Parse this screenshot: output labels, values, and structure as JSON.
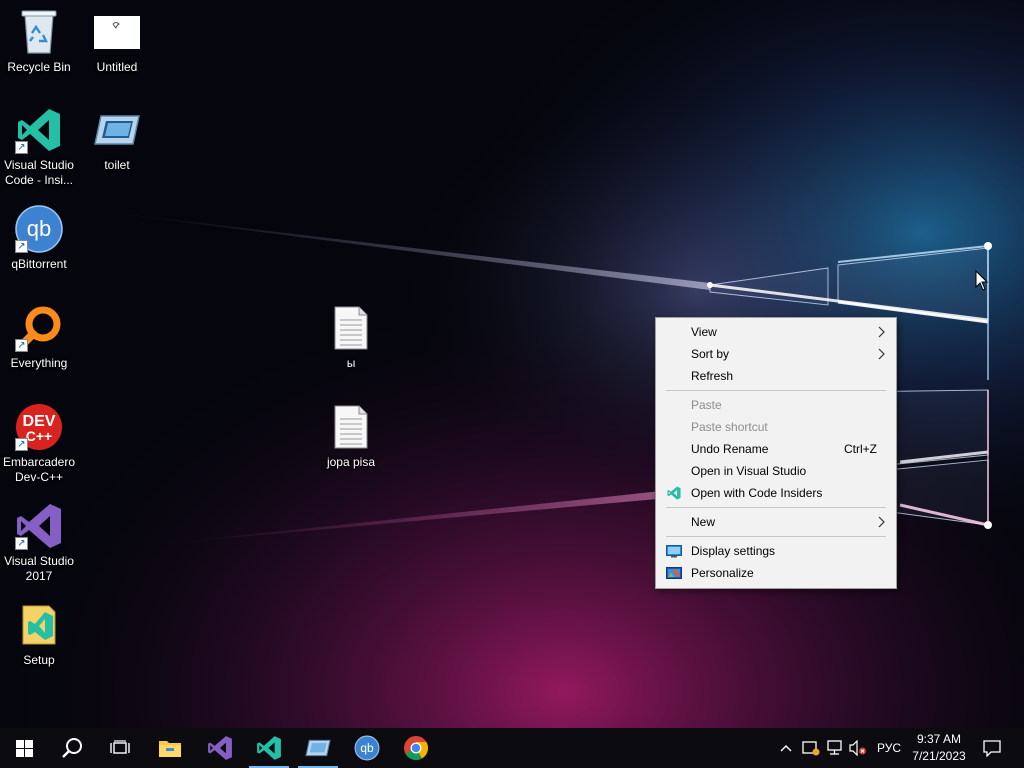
{
  "desktop": {
    "icons": [
      {
        "label": "Recycle Bin"
      },
      {
        "label": "Untitled"
      },
      {
        "label": "Visual Studio Code - Insi..."
      },
      {
        "label": "toilet"
      },
      {
        "label": "qBittorrent"
      },
      {
        "label": "Everything"
      },
      {
        "label": "ы"
      },
      {
        "label": "Embarcadero Dev-C++"
      },
      {
        "label": "jopa pisa"
      },
      {
        "label": "Visual Studio 2017"
      },
      {
        "label": "Setup"
      }
    ],
    "badges": {
      "qb": "qb",
      "dev_top": "DEV",
      "dev_bottom": "C++"
    }
  },
  "context_menu": {
    "items": [
      {
        "label": "View",
        "submenu": true
      },
      {
        "label": "Sort by",
        "submenu": true
      },
      {
        "label": "Refresh"
      },
      {
        "label": "Paste",
        "disabled": true
      },
      {
        "label": "Paste shortcut",
        "disabled": true
      },
      {
        "label": "Undo Rename",
        "shortcut": "Ctrl+Z"
      },
      {
        "label": "Open in Visual Studio"
      },
      {
        "label": "Open with Code Insiders",
        "icon": "vscode-insiders-icon"
      },
      {
        "label": "New",
        "submenu": true
      },
      {
        "label": "Display settings",
        "icon": "display-icon"
      },
      {
        "label": "Personalize",
        "icon": "personalize-icon"
      }
    ]
  },
  "taskbar": {
    "apps": [
      "start-icon",
      "search-icon",
      "task-view-icon",
      "file-explorer-icon",
      "visual-studio-icon",
      "vscode-insiders-icon",
      "toilet-app-icon",
      "qbittorrent-icon",
      "chrome-icon"
    ],
    "tray": {
      "language": "РУС",
      "time": "9:37 AM",
      "date": "7/21/2023"
    }
  },
  "colors": {
    "accent": "#76b9ed",
    "menu_bg": "#f2f2f2",
    "taskbar_bg": "#0c0c10",
    "vscode_insiders": "#24bfa5",
    "visual_studio": "#865fc5"
  }
}
